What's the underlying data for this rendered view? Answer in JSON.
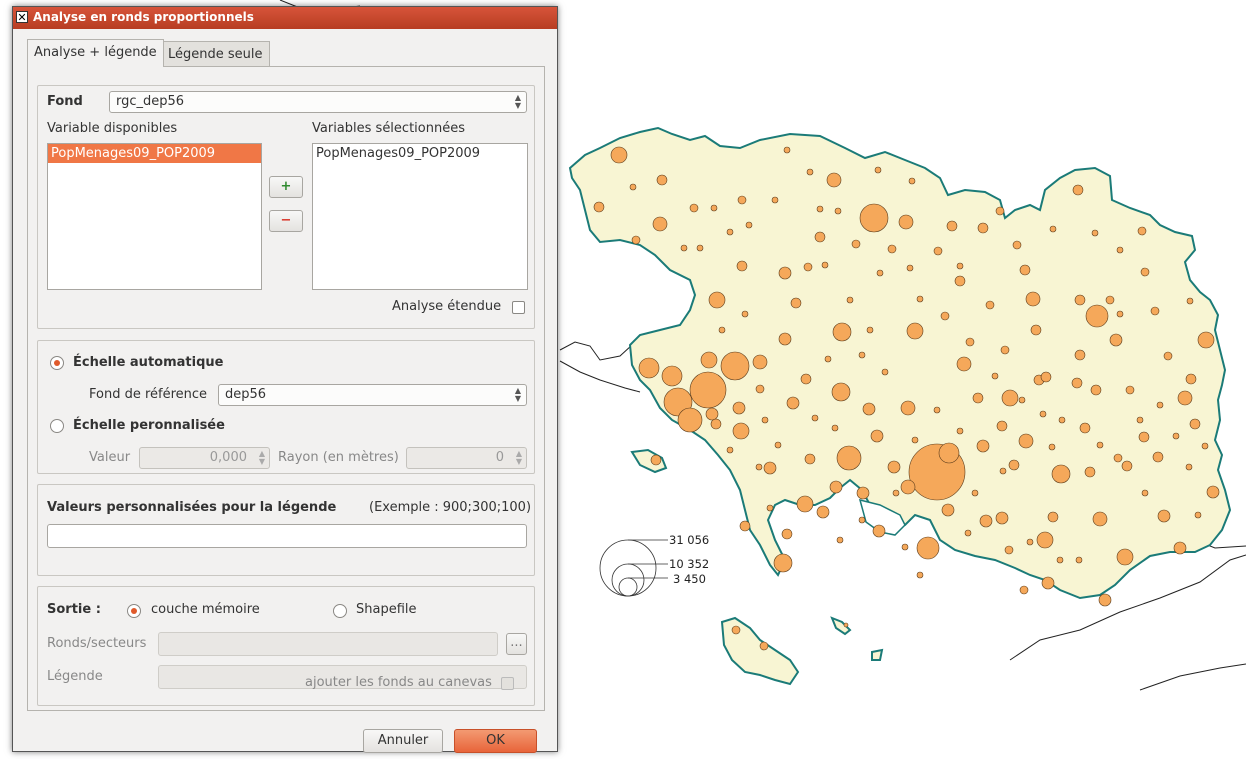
{
  "window": {
    "title": "Analyse en ronds proportionnels"
  },
  "tabs": [
    "Analyse + légende",
    "Légende seule"
  ],
  "fond": {
    "label": "Fond",
    "value": "rgc_dep56"
  },
  "variables": {
    "available_label": "Variable disponibles",
    "available_items": [
      "PopMenages09_POP2009"
    ],
    "selected_label": "Variables sélectionnées",
    "selected_items": [
      "PopMenages09_POP2009"
    ],
    "add_button": "+",
    "remove_button": "−",
    "extended_label": "Analyse étendue"
  },
  "scale": {
    "auto_label": "Échelle automatique",
    "reference_label": "Fond de référence",
    "reference_value": "dep56",
    "custom_label": "Échelle peronnalisée",
    "value_label": "Valeur",
    "value_value": "0,000",
    "radius_label": "Rayon (en mètres)",
    "radius_value": "0"
  },
  "legend_values": {
    "label": "Valeurs personnalisées pour la légende",
    "example": "(Exemple : 900;300;100)",
    "value": ""
  },
  "output": {
    "label": "Sortie :",
    "memory_label": "couche mémoire",
    "shapefile_label": "Shapefile",
    "circles_label": "Ronds/secteurs",
    "legend_label": "Légende",
    "browse_label": "...",
    "add_to_canvas_label": "ajouter les fonds au canevas"
  },
  "buttons": {
    "cancel": "Annuler",
    "ok": "OK"
  },
  "map_legend": {
    "values": [
      "31 056",
      "10 352",
      "3 450"
    ]
  },
  "colors": {
    "land": "#f8f5d3",
    "coast": "#1b7b78",
    "circle": "#f5a85a",
    "accent": "#f07746"
  }
}
